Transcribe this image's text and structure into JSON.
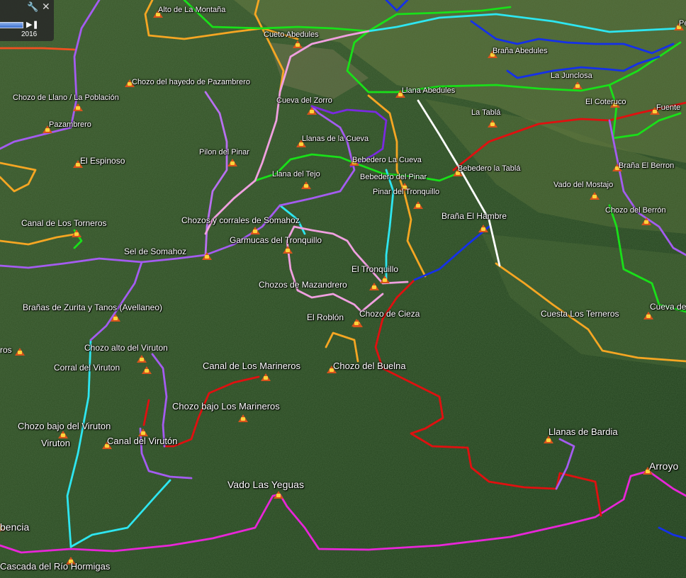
{
  "time_slider": {
    "year": "2016",
    "tool_icon": "wrench-icon",
    "close_icon": "close-icon",
    "next_icon": "skip-next-icon"
  },
  "placemarks": [
    {
      "name": "Alto de La Montaña"
    },
    {
      "name": "Cueto Abedules"
    },
    {
      "name": "Pe"
    },
    {
      "name": "Braña Abedules"
    },
    {
      "name": "La Junclosa"
    },
    {
      "name": "Chozo del hayedo de Pazambrero"
    },
    {
      "name": "Llana Abedules"
    },
    {
      "name": "Chozo de Llano / La Población"
    },
    {
      "name": "Cueva del Zorro"
    },
    {
      "name": "El Coteruco"
    },
    {
      "name": "Fuente"
    },
    {
      "name": "La Tablá"
    },
    {
      "name": "Pazambrero"
    },
    {
      "name": "Llanas de la Cueva"
    },
    {
      "name": "Pilon del Pinar"
    },
    {
      "name": "El Espinoso"
    },
    {
      "name": "Bebedero La Cueva"
    },
    {
      "name": "Braña El Berron"
    },
    {
      "name": "Llana del Tejo"
    },
    {
      "name": "Bebedero del Pinar"
    },
    {
      "name": "Bebedero la Tablá"
    },
    {
      "name": "Vado del Mostajo"
    },
    {
      "name": "Pinar del Tronquillo"
    },
    {
      "name": "Chozo del Berrón"
    },
    {
      "name": "Braña El Hambre"
    },
    {
      "name": "Chozos y corrales de Somahoz"
    },
    {
      "name": "Canal de Los Torneros"
    },
    {
      "name": "Garmucas del Tronquillo"
    },
    {
      "name": "Sel de Somahoz"
    },
    {
      "name": "El Tronquillo"
    },
    {
      "name": "Chozos de Mazandrero"
    },
    {
      "name": "Brañas de Zurita y Tanos (Avellaneo)"
    },
    {
      "name": "Cueva de Lo"
    },
    {
      "name": "Chozo de Cieza"
    },
    {
      "name": "Cuesta Los Terneros"
    },
    {
      "name": "El Roblón"
    },
    {
      "name": "Chozo alto del Viruton"
    },
    {
      "name": "ros"
    },
    {
      "name": "Corral del Viruton"
    },
    {
      "name": "Canal de Los Marineros"
    },
    {
      "name": "Chozo del Buelna"
    },
    {
      "name": "Chozo bajo Los Marineros"
    },
    {
      "name": "Chozo bajo del Viruton"
    },
    {
      "name": "Llanas de Bardia"
    },
    {
      "name": "Viruton"
    },
    {
      "name": "Canal del Virutón"
    },
    {
      "name": "Arroyo"
    },
    {
      "name": "Vado Las Yeguas"
    },
    {
      "name": "bencia"
    },
    {
      "name": "Cascada del Río Hormigas"
    }
  ],
  "route_colors": {
    "magenta": "#e826d8",
    "red": "#e01010",
    "orange": "#f5a623",
    "green": "#19e019",
    "cyan": "#2ee6f0",
    "blue": "#1530e8",
    "violet": "#a45cf0",
    "purple": "#7a2ae0",
    "pink": "#f0a0e0",
    "white": "#ffffff",
    "light_purple": "#b870f0",
    "orange_red": "#f05020"
  },
  "pin_icon": "placemark-icon"
}
